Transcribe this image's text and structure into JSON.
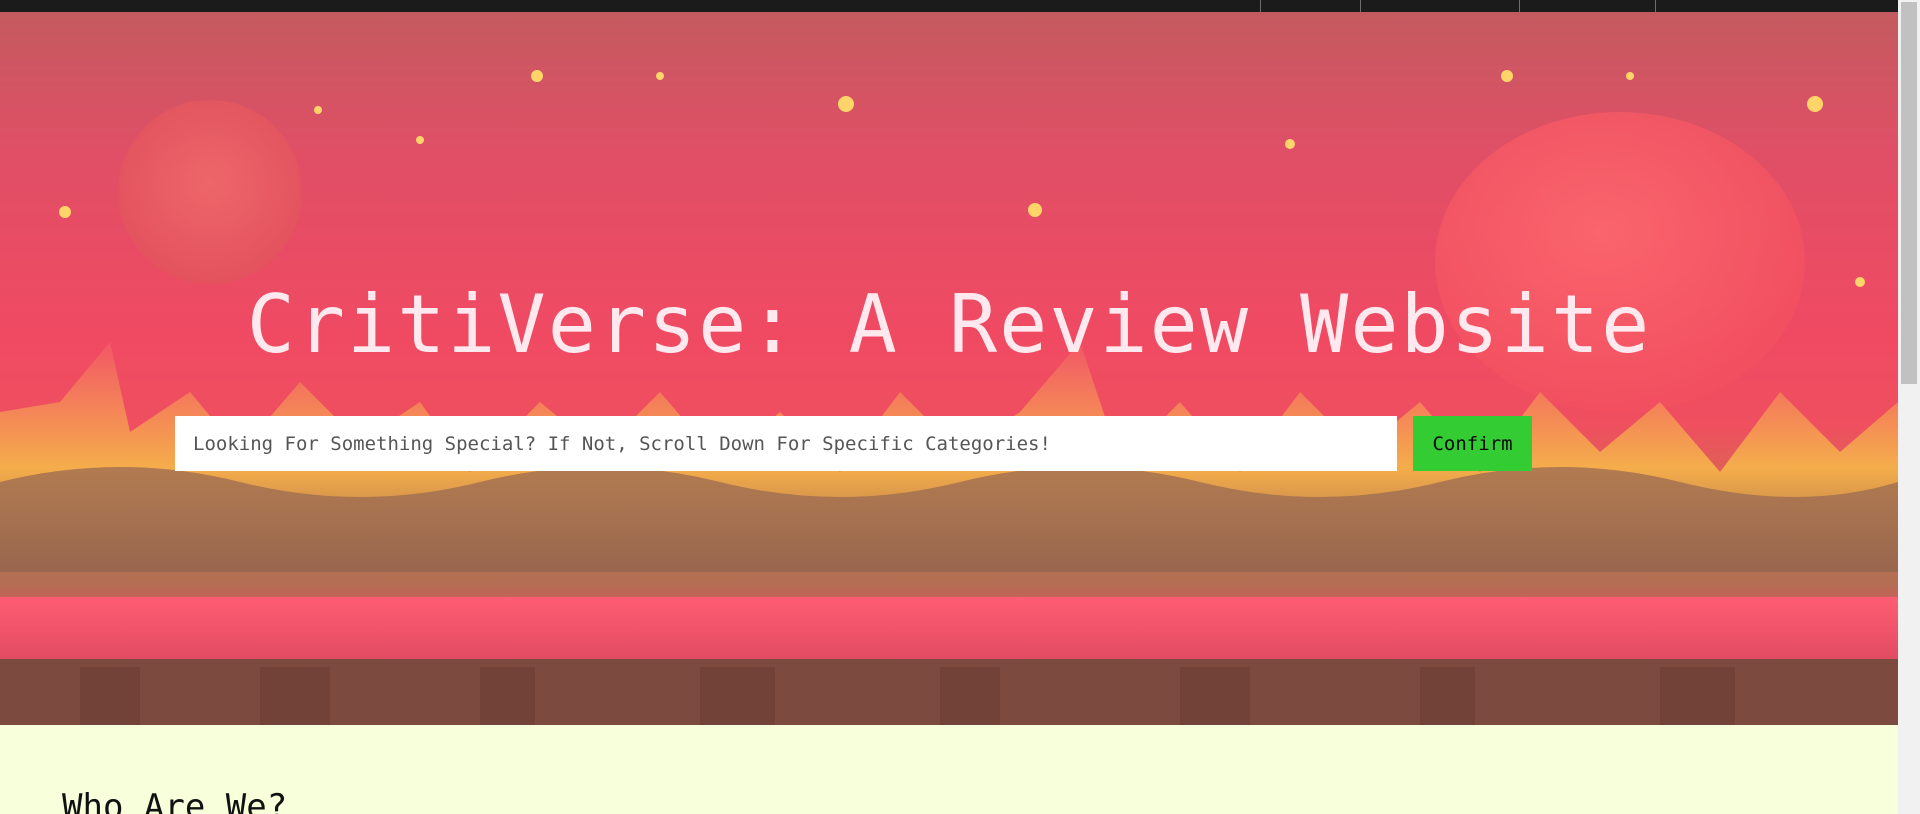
{
  "nav": {
    "items": [
      "",
      "",
      "",
      ""
    ]
  },
  "hero": {
    "title": "CritiVerse: A Review Website",
    "search": {
      "value": "",
      "placeholder": "Looking For Something Special? If Not, Scroll Down For Specific Categories!",
      "confirm_label": "Confirm"
    }
  },
  "about": {
    "heading": "Who Are We?"
  },
  "colors": {
    "topbar": "#1b1b1b",
    "confirm_button": "#33cc33",
    "about_background": "#f7ffdb",
    "title_text": "#ffe9ee"
  }
}
